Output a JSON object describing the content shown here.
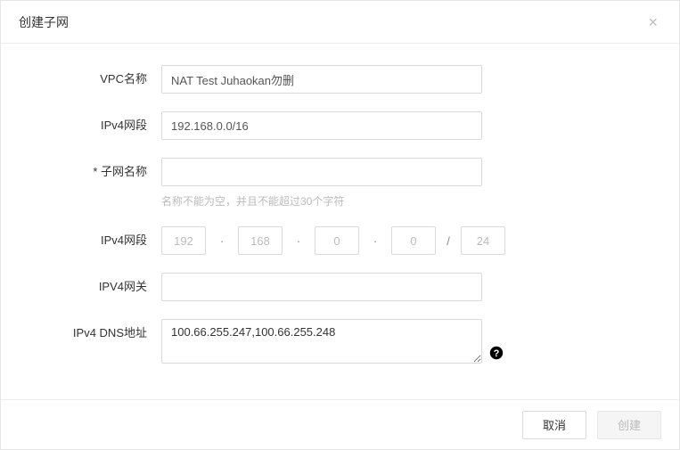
{
  "dialog": {
    "title": "创建子网"
  },
  "form": {
    "vpc_name": {
      "label": "VPC名称",
      "value": "NAT Test Juhaokan勿删"
    },
    "ipv4_range": {
      "label": "IPv4网段",
      "value": "192.168.0.0/16"
    },
    "subnet_name": {
      "label": "* 子网名称",
      "value": "",
      "hint": "名称不能为空，并且不能超过30个字符"
    },
    "subnet_range": {
      "label": "IPv4网段",
      "oct1": "192",
      "oct2": "168",
      "oct3": "0",
      "oct4": "0",
      "mask": "24"
    },
    "ipv4_gateway": {
      "label": "IPV4网关",
      "value": ""
    },
    "ipv4_dns": {
      "label": "IPv4 DNS地址",
      "value": "100.66.255.247,100.66.255.248"
    }
  },
  "footer": {
    "cancel": "取消",
    "submit": "创建"
  },
  "sep": {
    "dot": "·",
    "slash": "/"
  }
}
